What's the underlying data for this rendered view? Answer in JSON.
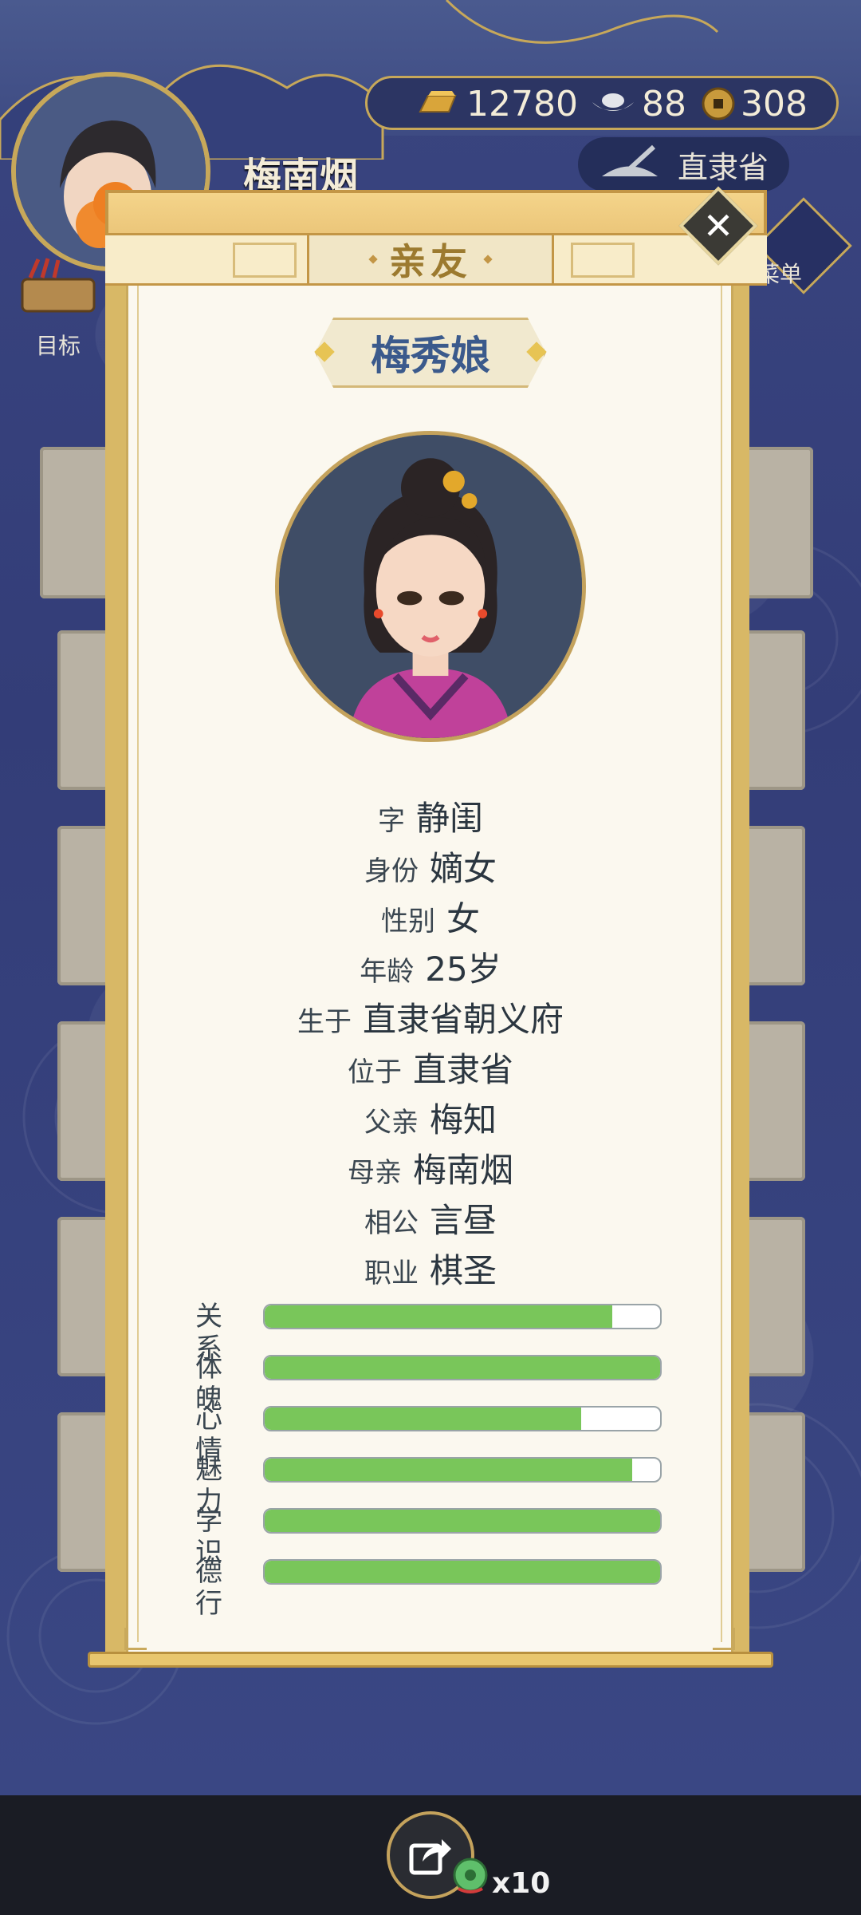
{
  "hud": {
    "player_name": "梅南烟",
    "gold": "12780",
    "silver": "88",
    "coin": "308",
    "province": "直隶省",
    "menu_label": "菜单",
    "goal_label": "目标"
  },
  "panel": {
    "title": "亲友",
    "person_name": "梅秀娘",
    "info": [
      {
        "label": "字",
        "value": "静闺"
      },
      {
        "label": "身份",
        "value": "嫡女"
      },
      {
        "label": "性别",
        "value": "女"
      },
      {
        "label": "年龄",
        "value": "25岁"
      },
      {
        "label": "生于",
        "value": "直隶省朝义府"
      },
      {
        "label": "位于",
        "value": "直隶省"
      },
      {
        "label": "父亲",
        "value": "梅知"
      },
      {
        "label": "母亲",
        "value": "梅南烟"
      },
      {
        "label": "相公",
        "value": "言昼"
      },
      {
        "label": "职业",
        "value": "棋圣"
      }
    ],
    "stats": [
      {
        "label": "关系",
        "level": 0.88
      },
      {
        "label": "体魄",
        "level": 1.0
      },
      {
        "label": "心情",
        "level": 0.8
      },
      {
        "label": "魅力",
        "level": 0.93
      },
      {
        "label": "学识",
        "level": 1.0
      },
      {
        "label": "德行",
        "level": 1.0
      }
    ]
  },
  "share": {
    "count": "x10"
  }
}
